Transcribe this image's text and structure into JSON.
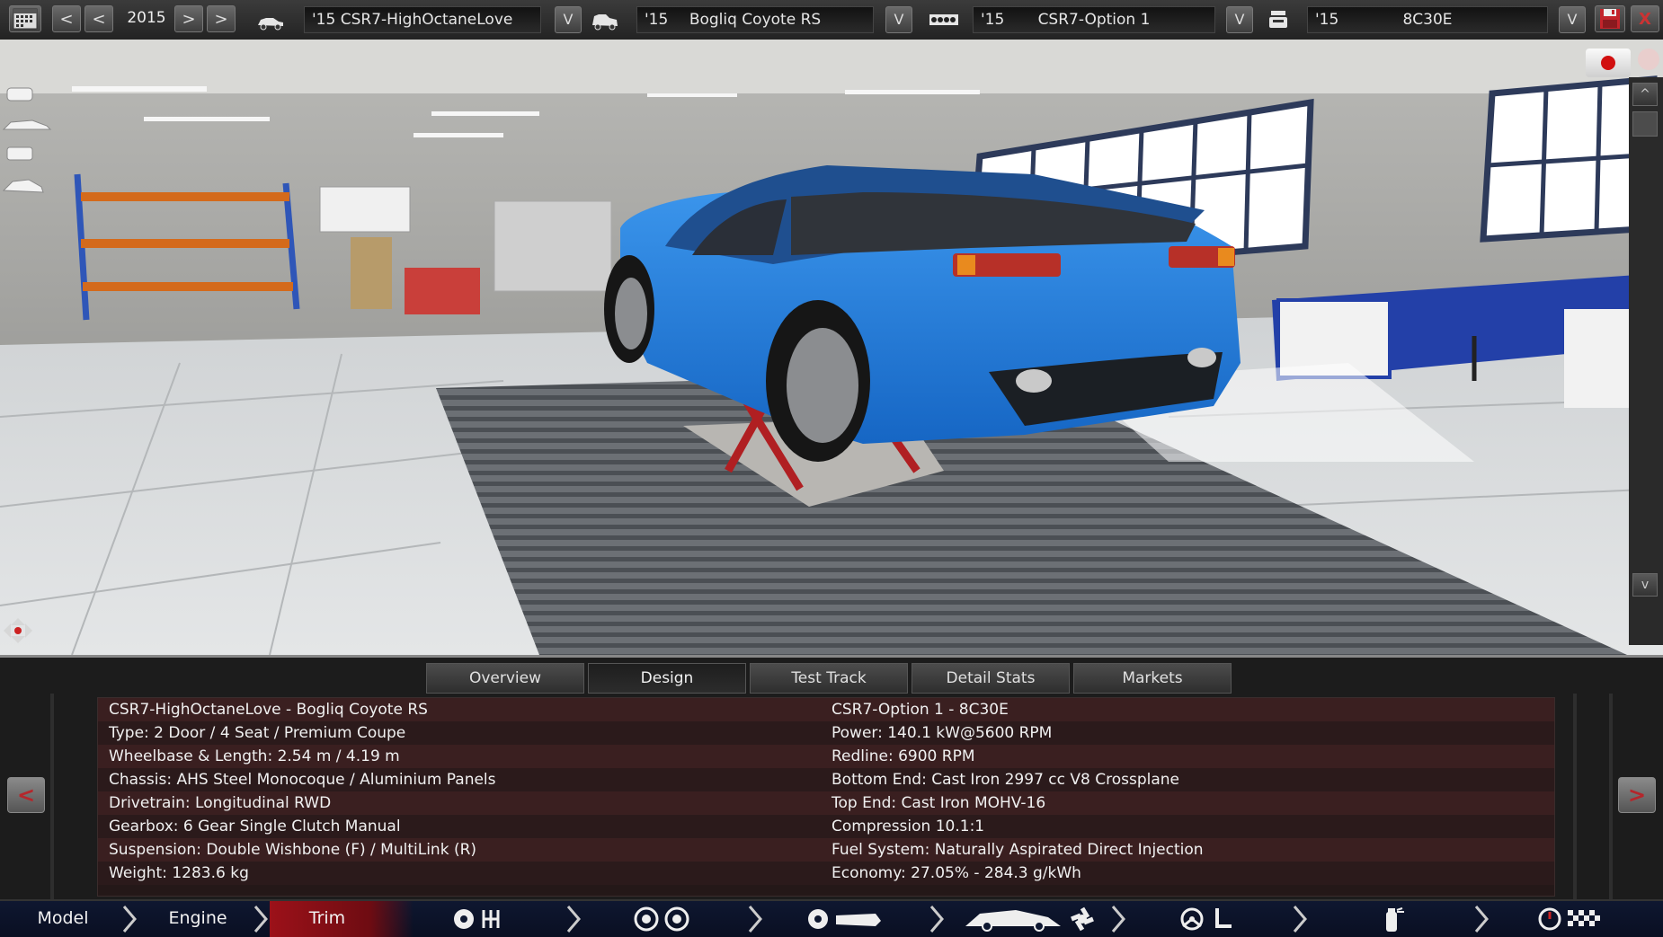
{
  "toolbar": {
    "year": "2015",
    "model": {
      "year": "'15",
      "name": "CSR7-HighOctaneLove"
    },
    "trim": {
      "year": "'15",
      "name": "Bogliq Coyote RS"
    },
    "engine_family": {
      "year": "'15",
      "name": "CSR7-Option 1"
    },
    "engine_variant": {
      "year": "'15",
      "name": "8C30E"
    },
    "prev_labels": [
      "<",
      "<"
    ],
    "next_labels": [
      ">",
      ">"
    ],
    "dropdown_label": "V",
    "close_label": "X"
  },
  "view_controls": {
    "scroll_up_label": "^",
    "scroll_down_label": "v"
  },
  "tabs": [
    {
      "label": "Overview",
      "active": false
    },
    {
      "label": "Design",
      "active": true
    },
    {
      "label": "Test Track",
      "active": false
    },
    {
      "label": "Detail Stats",
      "active": false
    },
    {
      "label": "Markets",
      "active": false
    }
  ],
  "stats": {
    "left": [
      "CSR7-HighOctaneLove - Bogliq Coyote RS",
      "Type: 2 Door / 4 Seat / Premium Coupe",
      "Wheelbase & Length: 2.54 m / 4.19 m",
      "Chassis: AHS Steel Monocoque / Aluminium Panels",
      "Drivetrain: Longitudinal RWD",
      "Gearbox: 6 Gear Single Clutch Manual",
      "Suspension: Double Wishbone (F) / MultiLink (R)",
      "Weight: 1283.6 kg"
    ],
    "right": [
      "CSR7-Option 1 - 8C30E",
      "Power: 140.1 kW@5600 RPM",
      "Redline: 6900 RPM",
      "Bottom End: Cast Iron 2997 cc V8 Crossplane",
      "Top End: Cast Iron MOHV-16",
      "Compression 10.1:1",
      "Fuel System: Naturally Aspirated Direct Injection",
      "Economy: 27.05% - 284.3 g/kWh"
    ],
    "prev_label": "<",
    "next_label": ">"
  },
  "nav": [
    {
      "label": "Model",
      "active": false
    },
    {
      "label": "Engine",
      "active": false
    },
    {
      "label": "Trim",
      "active": true
    }
  ],
  "colors": {
    "car_body": "#2a86e0",
    "accent_red": "#b5262b",
    "nav_active": "#9c1119"
  }
}
